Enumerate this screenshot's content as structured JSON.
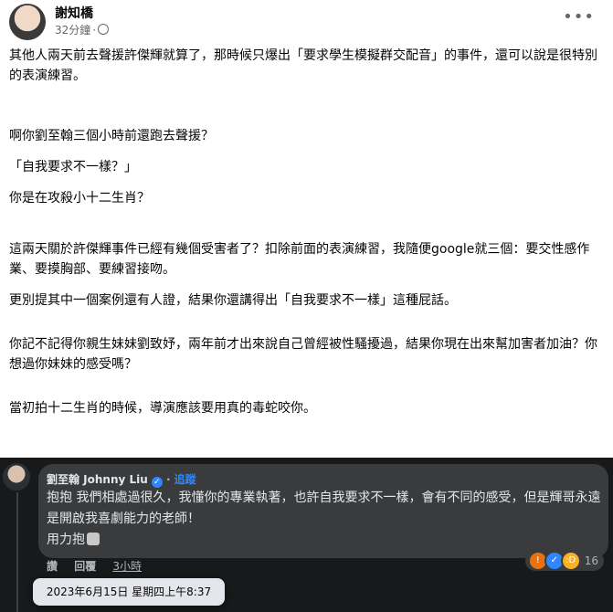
{
  "post": {
    "author": "謝知橋",
    "time": "32分鐘",
    "dot": "·",
    "more": "•••",
    "paragraphs": [
      "其他人兩天前去聲援許傑輝就算了，那時候只爆出「要求學生模擬群交配音」的事件，還可以說是很特別的表演練習。",
      "",
      "啊你劉至翰三個小時前還跑去聲援？",
      "",
      "「自我要求不一樣？」",
      "",
      "你是在攻殺小十二生肖？",
      "",
      "這兩天關於許傑輝事件已經有幾個受害者了？扣除前面的表演練習，我隨便google就三個：要交性感作業、要摸胸部、要練習接吻。",
      "",
      "更別提其中一個案例還有人證，結果你還講得出「自我要求不一樣」這種屁話。",
      "",
      "你記不記得你親生妹妹劉致妤，兩年前才出來說自己曾經被性騷擾過，結果你現在出來幫加害者加油？你想過你妹妹的感受嗎？",
      "",
      "當初拍十二生肖的時候，導演應該要用真的毒蛇咬你。"
    ]
  },
  "comment": {
    "author": "劉至翰 Johnny Liu",
    "verified_mark": "✓",
    "follow_separator": "·",
    "follow_label": "追蹤",
    "lines": [
      "抱抱 我們相處過很久，我懂你的專業執著，也許自我要求不一樣，會有不同的感受，但是輝哥永遠是開啟我喜劇能力的老師！",
      "",
      "用力抱"
    ],
    "actions": {
      "like": "讚",
      "reply": "回覆",
      "time": "3小時"
    },
    "reactions": {
      "count": "16",
      "types": [
        "angry",
        "like",
        "haha"
      ]
    }
  },
  "tooltip": {
    "text": "2023年6月15日 星期四上午8:37"
  },
  "colors": {
    "comment_bg": "#18191a",
    "bubble_bg": "#3a3b3c",
    "accent": "#2d88ff"
  }
}
